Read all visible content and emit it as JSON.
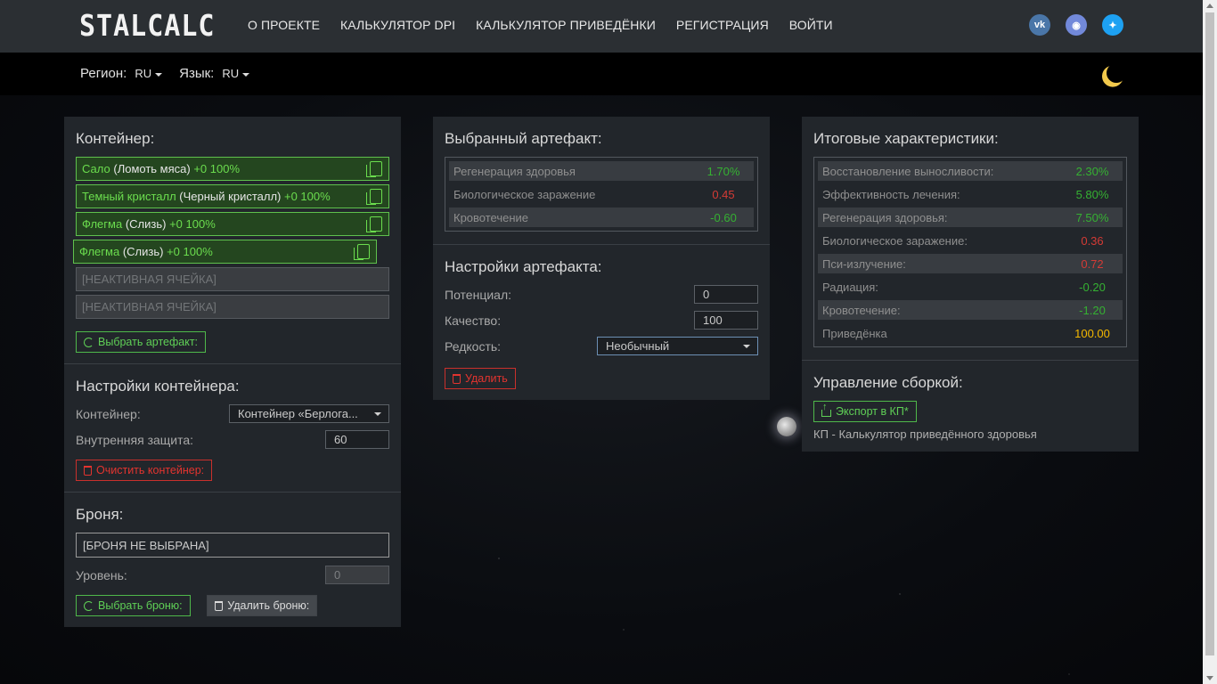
{
  "header": {
    "logo": "STALCALC",
    "nav": [
      "О ПРОЕКТЕ",
      "КАЛЬКУЛЯТОР DPI",
      "КАЛЬКУЛЯТОР ПРИВЕДЁНКИ",
      "РЕГИСТРАЦИЯ",
      "ВОЙТИ"
    ],
    "social": [
      {
        "icon": "vk-icon",
        "glyph": "vk"
      },
      {
        "icon": "discord-icon",
        "glyph": "d"
      },
      {
        "icon": "twitter-icon",
        "glyph": "t"
      }
    ]
  },
  "subbar": {
    "region_label": "Регион:",
    "region_value": "RU",
    "lang_label": "Язык:",
    "lang_value": "RU",
    "theme_icon": "moon-icon"
  },
  "container_panel": {
    "title": "Контейнер:",
    "slots": [
      {
        "name": "Сало",
        "alt": "(Ломоть мяса)",
        "bonus": "+0 100%"
      },
      {
        "name": "Темный кристалл",
        "alt": "(Черный кристалл)",
        "bonus": "+0 100%"
      },
      {
        "name": "Флегма",
        "alt": "(Слизь)",
        "bonus": "+0 100%"
      },
      {
        "name": "Флегма",
        "alt": "(Слизь)",
        "bonus": "+0 100%"
      }
    ],
    "inactive_slot_label": "[НЕАКТИВНАЯ ЯЧЕЙКА]",
    "select_artifact_btn": "Выбрать артефакт:",
    "settings_title": "Настройки контейнера:",
    "container_label": "Контейнер:",
    "container_value": "Контейнер «Берлога...",
    "inner_protection_label": "Внутренняя защита:",
    "inner_protection_value": "60",
    "clear_btn": "Очистить контейнер:",
    "armor_title": "Броня:",
    "armor_value": "[БРОНЯ НЕ ВЫБРАНА]",
    "level_label": "Уровень:",
    "level_value": "0",
    "select_armor_btn": "Выбрать броню:",
    "delete_armor_btn": "Удалить броню:"
  },
  "artifact_panel": {
    "title": "Выбранный артефакт:",
    "stats": [
      {
        "label": "Регенерация здоровья",
        "value": "1.70%",
        "color": "#35b132"
      },
      {
        "label": "Биологическое заражение",
        "value": "0.45",
        "color": "#d43b35"
      },
      {
        "label": "Кровотечение",
        "value": "-0.60",
        "color": "#35b132"
      }
    ],
    "settings_title": "Настройки артефакта:",
    "potential_label": "Потенциал:",
    "potential_value": "0",
    "quality_label": "Качество:",
    "quality_value": "100",
    "rarity_label": "Редкость:",
    "rarity_value": "Необычный",
    "delete_btn": "Удалить"
  },
  "result_panel": {
    "title": "Итоговые характеристики:",
    "stats": [
      {
        "label": "Восстановление выносливости:",
        "value": "2.30%",
        "color": "#35b132"
      },
      {
        "label": "Эффективность лечения:",
        "value": "5.80%",
        "color": "#35b132"
      },
      {
        "label": "Регенерация здоровья:",
        "value": "7.50%",
        "color": "#35b132"
      },
      {
        "label": "Биологическое заражение:",
        "value": "0.36",
        "color": "#d43b35"
      },
      {
        "label": "Пси-излучение:",
        "value": "0.72",
        "color": "#d43b35"
      },
      {
        "label": "Радиация:",
        "value": "-0.20",
        "color": "#35b132"
      },
      {
        "label": "Кровотечение:",
        "value": "-1.20",
        "color": "#35b132"
      },
      {
        "label": "Приведёнка",
        "value": "100.00",
        "color": "#f5b800"
      }
    ],
    "build_title": "Управление сборкой:",
    "export_btn": "Экспорт в КП*",
    "footnote": "КП - Калькулятор приведённого здоровья"
  }
}
